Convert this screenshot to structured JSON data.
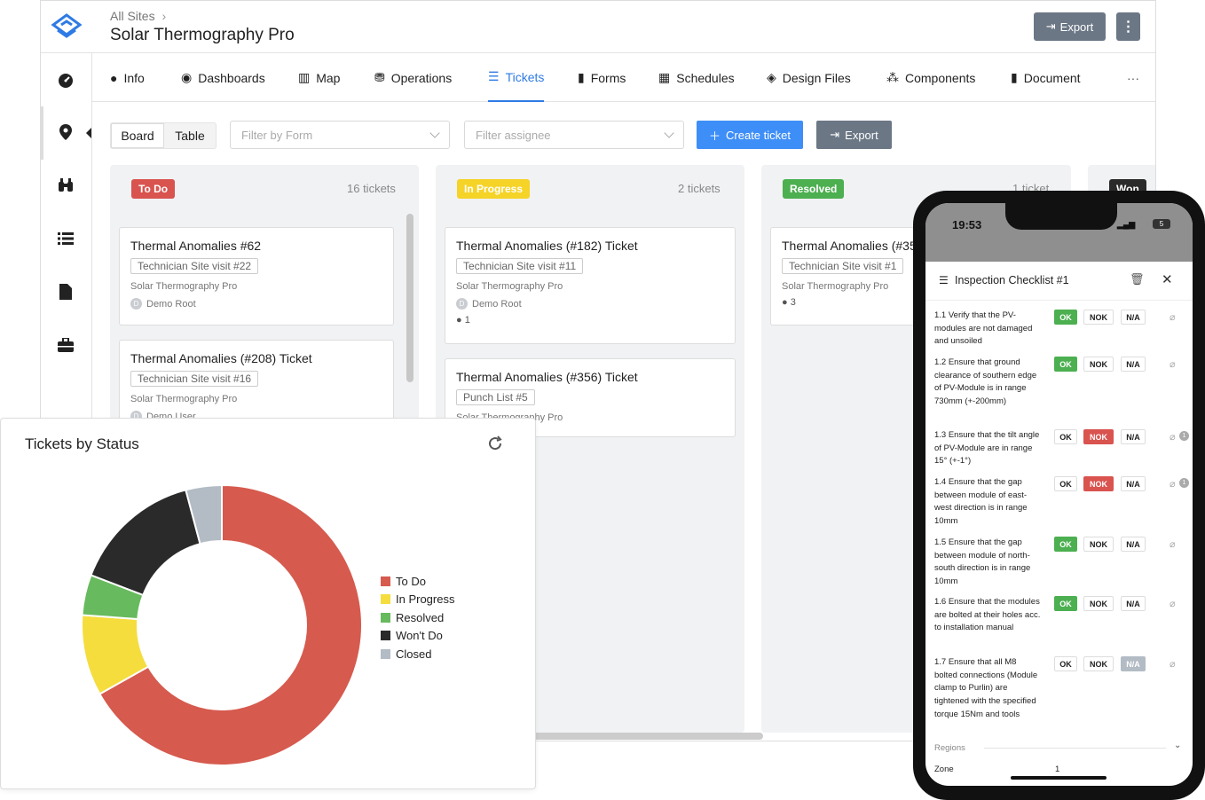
{
  "header": {
    "breadcrumb": "All Sites",
    "title": "Solar Thermography Pro",
    "export_label": "Export",
    "more_label": "⋮"
  },
  "nav": {
    "tabs": [
      "Info",
      "Dashboards",
      "Map",
      "Operations",
      "Tickets",
      "Forms",
      "Schedules",
      "Design Files",
      "Components",
      "Document"
    ],
    "active": "Tickets",
    "more": "···"
  },
  "toolbar": {
    "board": "Board",
    "table": "Table",
    "filter_form": "Filter by Form",
    "filter_assignee": "Filter assignee",
    "create": "Create ticket",
    "export": "Export"
  },
  "columns": [
    {
      "status": "To Do",
      "color": "#d9534f",
      "count": "16 tickets",
      "cards": [
        {
          "title": "Thermal Anomalies #62",
          "tag": "Technician Site visit #22",
          "site": "Solar Thermography Pro",
          "user": "Demo Root",
          "avatar": "D"
        },
        {
          "title": "Thermal Anomalies (#208) Ticket",
          "tag": "Technician Site visit #16",
          "site": "Solar Thermography Pro",
          "user": "Demo User",
          "avatar": "D"
        }
      ]
    },
    {
      "status": "In Progress",
      "color": "#f5d327",
      "count": "2 tickets",
      "cards": [
        {
          "title": "Thermal Anomalies (#182) Ticket",
          "tag": "Technician Site visit #11",
          "site": "Solar Thermography Pro",
          "user": "Demo Root",
          "avatar": "D",
          "comments": "1"
        },
        {
          "title": "Thermal Anomalies (#356) Ticket",
          "tag": "Punch List #5",
          "site": "Solar Thermography Pro"
        }
      ]
    },
    {
      "status": "Resolved",
      "color": "#4caf50",
      "count": "1 ticket",
      "cards": [
        {
          "title": "Thermal Anomalies (#35",
          "tag": "Technician Site visit #1",
          "site": "Solar Thermography Pro",
          "comments": "3"
        }
      ]
    },
    {
      "status": "Won"
    }
  ],
  "chart": {
    "title": "Tickets by Status"
  },
  "chart_data": {
    "type": "pie",
    "title": "Tickets by Status",
    "categories": [
      "To Do",
      "In Progress",
      "Resolved",
      "Won't Do",
      "Closed"
    ],
    "values": [
      64.5,
      9,
      4.5,
      14.5,
      4
    ],
    "colors": [
      "#d65a4e",
      "#f5dd3e",
      "#67ba5d",
      "#2a2a2a",
      "#b3bcc5"
    ],
    "legend": "right",
    "donut": true
  },
  "phone": {
    "time": "19:53",
    "battery": "5",
    "modal_title": "Inspection Checklist #1",
    "checklist": [
      {
        "text": "1.1 Verify that the PV-modules are not damaged and unsoiled",
        "sel": "OK"
      },
      {
        "text": "1.2 Ensure that ground clearance of southern edge of PV-Module is in range 730mm (+-200mm)",
        "sel": "OK"
      },
      {
        "text": "1.3 Ensure that the tilt angle of PV-Module are in range 15° (+-1°)",
        "sel": "NOK",
        "badge": "1"
      },
      {
        "text": "1.4 Ensure that the gap between module of east-west direction is in range 10mm",
        "sel": "NOK",
        "badge": "1"
      },
      {
        "text": "1.5 Ensure that the gap between module of north-south direction is in range 10mm",
        "sel": "OK"
      },
      {
        "text": "1.6 Ensure that the modules are bolted at their holes acc. to installation manual",
        "sel": "OK"
      },
      {
        "text": "1.7 Ensure that all M8 bolted connections (Module clamp to Purlin) are tightened with the specified torque 15Nm and tools",
        "sel": "N/A"
      }
    ],
    "labels": {
      "ok": "OK",
      "nok": "NOK",
      "na": "N/A"
    },
    "regions": "Regions",
    "zone_label": "Zone",
    "zone_value": "1"
  }
}
